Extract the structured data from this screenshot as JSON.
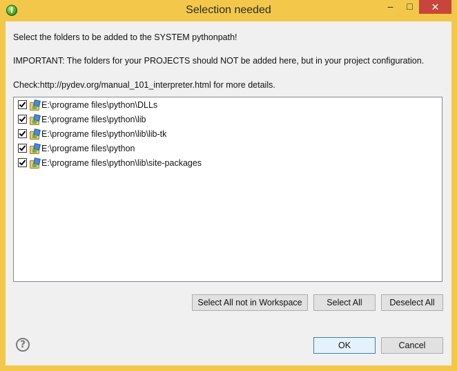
{
  "window": {
    "title": "Selection needed",
    "controls": {
      "minimize": "–",
      "maximize": "□",
      "close": "✕"
    }
  },
  "messages": {
    "line1": "Select the folders to be added to the SYSTEM pythonpath!",
    "line2": "IMPORTANT: The folders for your PROJECTS should NOT be added here, but in your project configuration.",
    "line3": "Check:http://pydev.org/manual_101_interpreter.html for more details."
  },
  "folders": [
    {
      "path": "E:\\programe files\\python\\DLLs",
      "checked": true
    },
    {
      "path": "E:\\programe files\\python\\lib",
      "checked": true
    },
    {
      "path": "E:\\programe files\\python\\lib\\lib-tk",
      "checked": true
    },
    {
      "path": "E:\\programe files\\python",
      "checked": true
    },
    {
      "path": "E:\\programe files\\python\\lib\\site-packages",
      "checked": true
    }
  ],
  "buttons": {
    "select_not_in_workspace": "Select All not in Workspace",
    "select_all": "Select All",
    "deselect_all": "Deselect All",
    "ok": "OK",
    "cancel": "Cancel",
    "help": "?"
  },
  "colors": {
    "title_bar": "#f3c84a",
    "close_button": "#c7453a",
    "default_button_border": "#3c7fb1"
  }
}
